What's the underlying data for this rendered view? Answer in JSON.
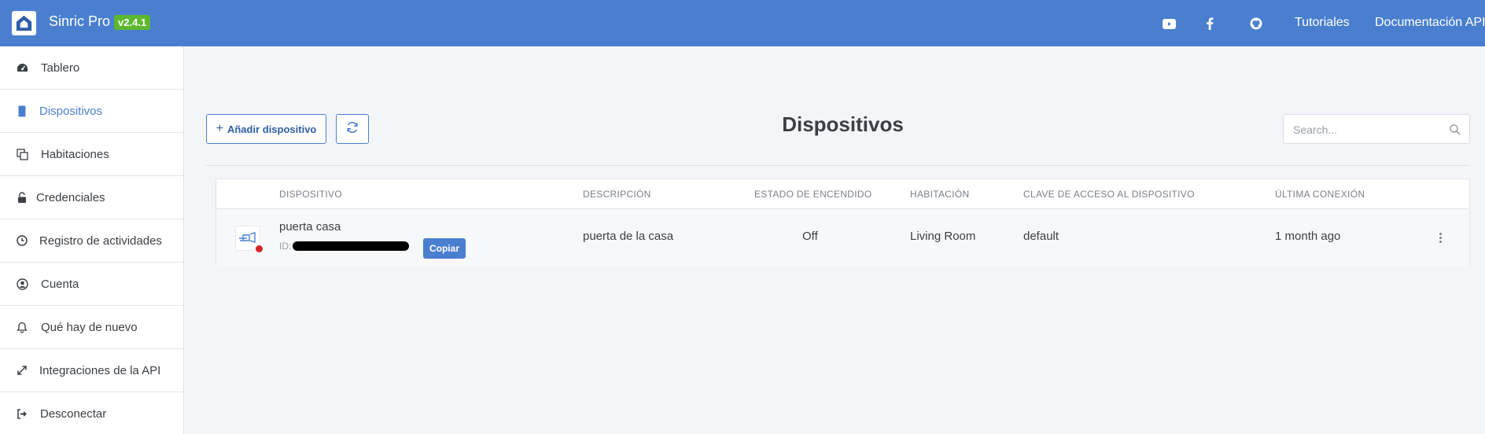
{
  "app": {
    "name": "Sinric Pro",
    "version": "v2.4.1"
  },
  "topnav": {
    "icons": [
      "youtube-icon",
      "facebook-icon",
      "github-icon"
    ],
    "links": [
      "Tutoriales",
      "Documentación API"
    ]
  },
  "sidebar": {
    "items": [
      {
        "label": "Tablero",
        "icon": "dashboard-icon"
      },
      {
        "label": "Dispositivos",
        "icon": "device-icon",
        "active": true
      },
      {
        "label": "Habitaciones",
        "icon": "rooms-icon"
      },
      {
        "label": "Credenciales",
        "icon": "unlock-icon"
      },
      {
        "label": "Registro de actividades",
        "icon": "clock-icon"
      },
      {
        "label": "Cuenta",
        "icon": "user-icon"
      },
      {
        "label": "Qué hay de nuevo",
        "icon": "bell-icon"
      },
      {
        "label": "Integraciones de la API",
        "icon": "expand-icon"
      },
      {
        "label": "Desconectar",
        "icon": "sign-out-icon"
      }
    ]
  },
  "main": {
    "add_label": "Añadir dispositivo",
    "title": "Dispositivos",
    "search_placeholder": "Search..."
  },
  "table": {
    "headers": [
      "DISPOSITIVO",
      "DESCRIPCIÓN",
      "ESTADO DE ENCENDIDO",
      "HABITACIÓN",
      "CLAVE DE ACCESO AL DISPOSITIVO",
      "ÚLTIMA CONEXIÓN"
    ],
    "rows": [
      {
        "name": "puerta casa",
        "id_label": "ID:",
        "copy_label": "Copiar",
        "description": "puerta de la casa",
        "power_state": "Off",
        "room": "Living Room",
        "access_key": "default",
        "last_connection": "1 month ago",
        "status_color": "#d22525"
      }
    ]
  },
  "colors": {
    "accent": "#4a7fd0",
    "version_badge": "#5cb82e",
    "offline": "#d22525"
  }
}
